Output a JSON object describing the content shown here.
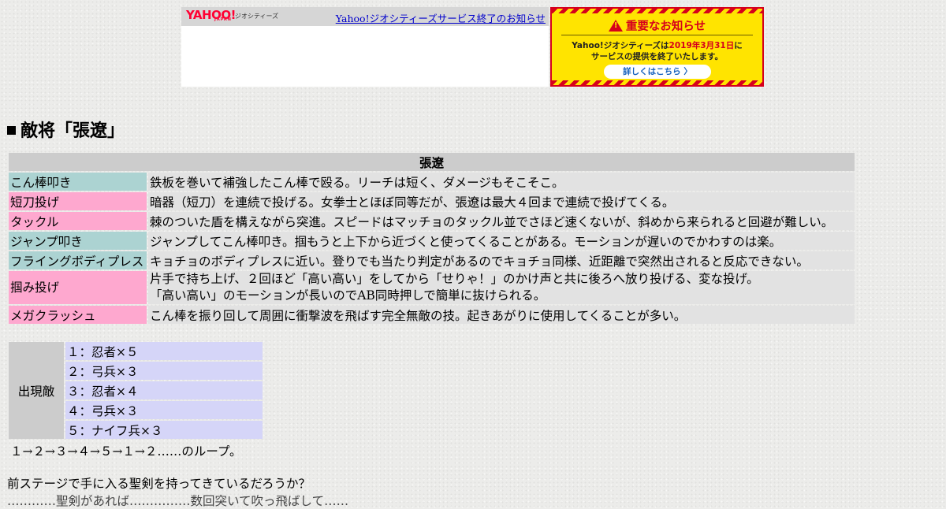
{
  "ad": {
    "logo_text": "YAHOO!",
    "logo_sub": "JAPAN",
    "logo_service": "ジオシティーズ",
    "link_text": "Yahoo!ジオシティーズサービス終了のお知らせ",
    "notice_title": "重要なお知らせ",
    "notice_line1_a": "Yahoo!ジオシティーズは",
    "notice_line1_date": "2019年3月31日",
    "notice_line1_b": "に",
    "notice_line2": "サービスの提供を終了いたします。",
    "notice_button": "詳しくはこちら 〉"
  },
  "heading": "敵将「張遼」",
  "moves_table": {
    "header": "張遼",
    "rows": [
      {
        "name": "こん棒叩き",
        "desc": "鉄板を巻いて補強したこん棒で殴る。リーチは短く、ダメージもそこそこ。"
      },
      {
        "name": "短刀投げ",
        "desc": "暗器（短刀）を連続で投げる。女拳士とほぼ同等だが、張遼は最大４回まで連続で投げてくる。"
      },
      {
        "name": "タックル",
        "desc": "棘のついた盾を構えながら突進。スピードはマッチョのタックル並でさほど速くないが、斜めから来られると回避が難しい。"
      },
      {
        "name": "ジャンプ叩き",
        "desc": "ジャンプしてこん棒叩き。掴もうと上下から近づくと使ってくることがある。モーションが遅いのでかわすのは楽。"
      },
      {
        "name": "フライングボディプレス",
        "desc": "キョチョのボディプレスに近い。登りでも当たり判定があるのでキョチョ同様、近距離で突然出されると反応できない。"
      },
      {
        "name": "掴み投げ",
        "desc": "片手で持ち上げ、２回ほど「高い高い」をしてから「せりゃ！」のかけ声と共に後ろへ放り投げる、変な投げ。",
        "desc2": "「高い高い」のモーションが長いのでAB同時押しで簡単に抜けられる。"
      },
      {
        "name": "メガクラッシュ",
        "desc": "こん棒を振り回して周囲に衝撃波を飛ばす完全無敵の技。起きあがりに使用してくることが多い。"
      }
    ]
  },
  "enemies_table": {
    "label": "出現敵",
    "items": [
      "１：忍者×５",
      "２：弓兵×３",
      "３：忍者×４",
      "４：弓兵×３",
      "５：ナイフ兵×３"
    ]
  },
  "loop_text": "１→２→３→４→５→１→２……のループ。",
  "paragraph": "前ステージで手に入る聖剣を持ってきているだろうか？",
  "paragraph2": "…………聖剣があれば……………数回突いて吹っ飛ばして……"
}
